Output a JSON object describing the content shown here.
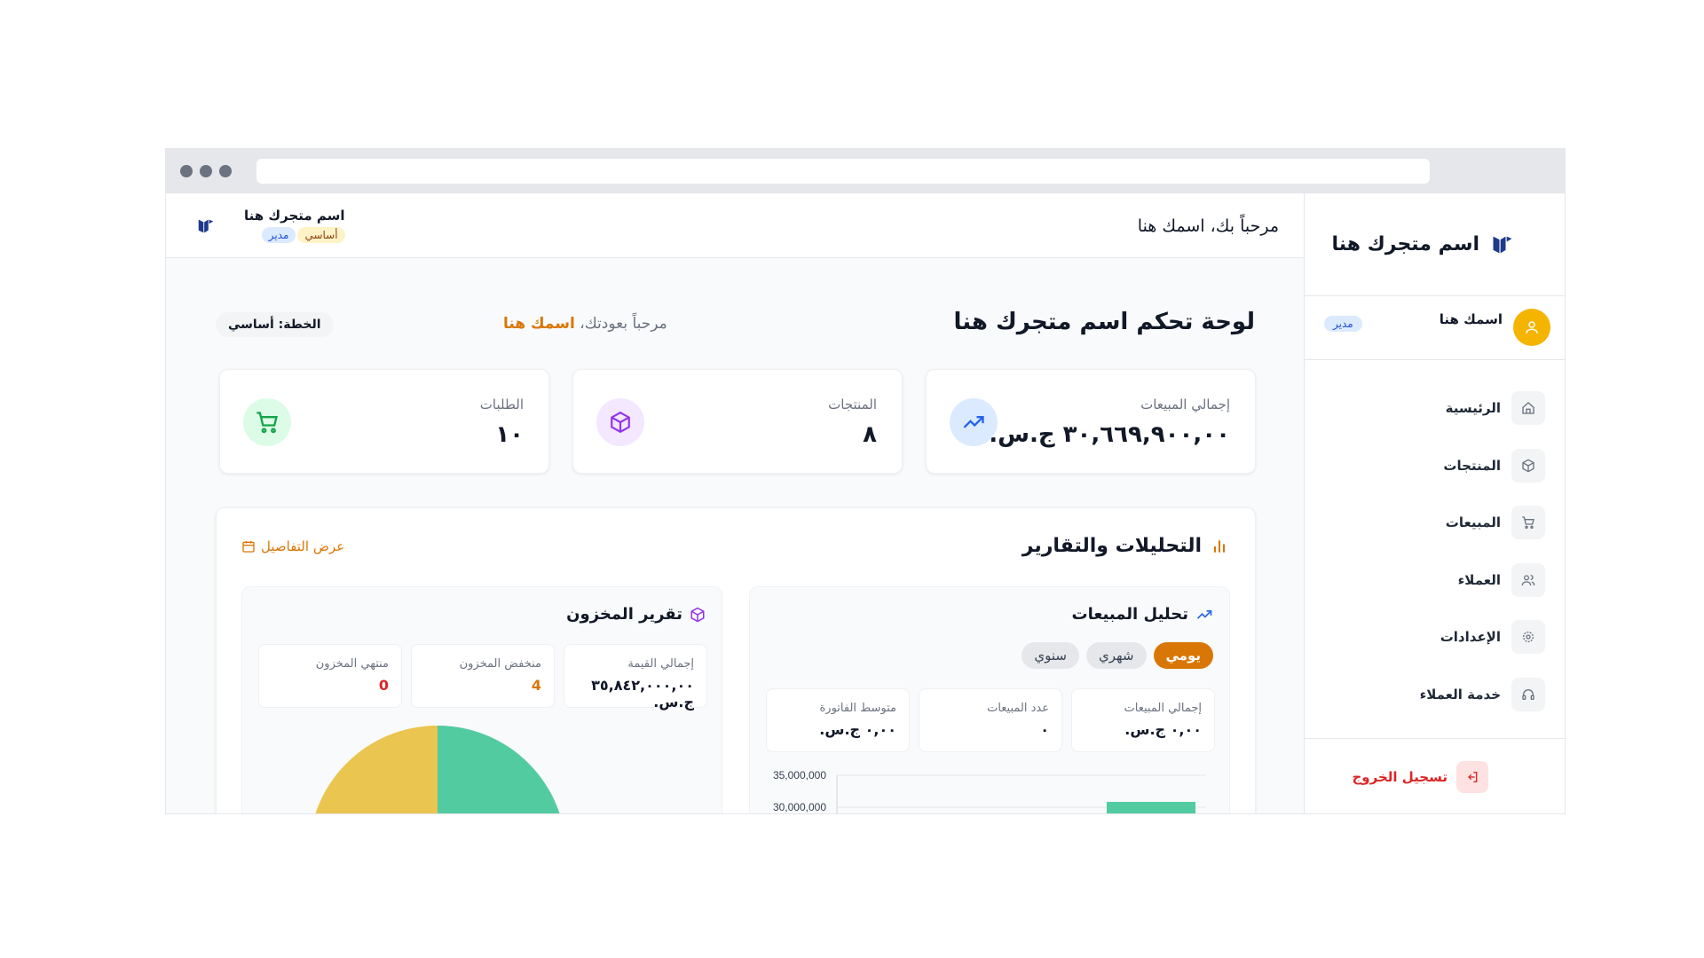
{
  "brand": {
    "store_name": "اسم متجرك هنا"
  },
  "user": {
    "name": "اسمك هنا",
    "role": "مدير"
  },
  "sidebar": {
    "items": [
      {
        "label": "الرئيسية",
        "icon": "home-icon"
      },
      {
        "label": "المنتجات",
        "icon": "box-icon"
      },
      {
        "label": "المبيعات",
        "icon": "cart-icon"
      },
      {
        "label": "العملاء",
        "icon": "users-icon"
      },
      {
        "label": "الإعدادات",
        "icon": "gear-icon"
      },
      {
        "label": "خدمة العملاء",
        "icon": "headset-icon"
      }
    ],
    "logout_label": "تسجيل الخروج"
  },
  "topbar": {
    "welcome": "مرحباً بك، اسمك هنا",
    "store_name": "اسم متجرك هنا",
    "plan_badge": "أساسي",
    "role_badge": "مدير"
  },
  "dashboard": {
    "title": "لوحة تحكم اسم متجرك هنا",
    "greeting_prefix": "مرحباً بعودتك،",
    "greeting_name": "اسمك هنا",
    "plan": "الخطة: أساسي"
  },
  "stats": {
    "sales": {
      "label": "إجمالي المبيعات",
      "value": "٣٠,٦٦٩,٩٠٠,٠٠ ج.س."
    },
    "products": {
      "label": "المنتجات",
      "value": "٨"
    },
    "orders": {
      "label": "الطلبات",
      "value": "١٠"
    }
  },
  "analytics": {
    "title": "التحليلات والتقارير",
    "details_link": "عرض التفاصيل",
    "sales_analysis": {
      "title": "تحليل المبيعات",
      "tabs": [
        "يومي",
        "شهري",
        "سنوي"
      ],
      "active_tab": "يومي",
      "metrics": [
        {
          "label": "إجمالي المبيعات",
          "value": "٠,٠٠ ج.س."
        },
        {
          "label": "عدد المبيعات",
          "value": "٠"
        },
        {
          "label": "متوسط الفاتورة",
          "value": "٠,٠٠ ج.س."
        }
      ]
    },
    "inventory": {
      "title": "تقرير المخزون",
      "metrics": [
        {
          "label": "إجمالي القيمة",
          "value": "٣٥,٨٤٢,٠٠٠,٠٠ ج.س."
        },
        {
          "label": "منخفض المخزون",
          "value": "4"
        },
        {
          "label": "منتهي المخزون",
          "value": "0"
        }
      ]
    }
  },
  "colors": {
    "accent": "#d97706",
    "danger": "#dc2626",
    "brand": "#1e3a8a",
    "pie_yellow": "#eac54f",
    "pie_green": "#52cba1"
  },
  "chart_data": [
    {
      "type": "bar",
      "y_ticks": [
        "35,000,000",
        "30,000,000"
      ],
      "visible_y_range": [
        30000000,
        35000000
      ],
      "values_visible": [
        30500000
      ]
    },
    {
      "type": "pie",
      "slices": [
        {
          "color": "#52cba1",
          "value": 0.5
        },
        {
          "color": "#eac54f",
          "value": 0.5
        }
      ]
    }
  ]
}
